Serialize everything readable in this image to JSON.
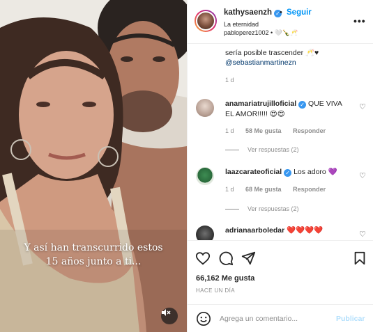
{
  "media": {
    "caption_line1": "Y así han transcurrido estos",
    "caption_line2": "15 años junto a ti...",
    "mute_icon": "speaker-muted-icon"
  },
  "header": {
    "username": "kathysaenzh",
    "separator": "•",
    "follow_label": "Seguir",
    "song": "La eternidad",
    "audio_line": "pabloperez1002 • 🤍🍾🥂",
    "more_label": "•••"
  },
  "comments": {
    "caption_tail": "sería posible trascender 🥂♥",
    "caption_mention": "@sebastianmartinezn",
    "caption_time": "1 d",
    "items": [
      {
        "username": "anamariatrujilloficial",
        "text": "QUE VIVA EL AMOR!!!!! 😍😍",
        "time": "1 d",
        "likes": "58 Me gusta",
        "reply": "Responder",
        "replies": "Ver respuestas (2)"
      },
      {
        "username": "laazcarateoficial",
        "text": "Los adoro 💜",
        "time": "1 d",
        "likes": "68 Me gusta",
        "reply": "Responder",
        "replies": "Ver respuestas (2)"
      },
      {
        "username": "adrianaarboledar",
        "text": "❤️❤️❤️❤️"
      }
    ]
  },
  "actions": {
    "likes": "66,162 Me gusta",
    "time_ago": "HACE UN DÍA"
  },
  "composer": {
    "placeholder": "Agrega un comentario...",
    "post_label": "Publicar"
  },
  "colors": {
    "accent": "#0095f6",
    "verified": "#3897f0",
    "muted": "#8e8e8e"
  }
}
